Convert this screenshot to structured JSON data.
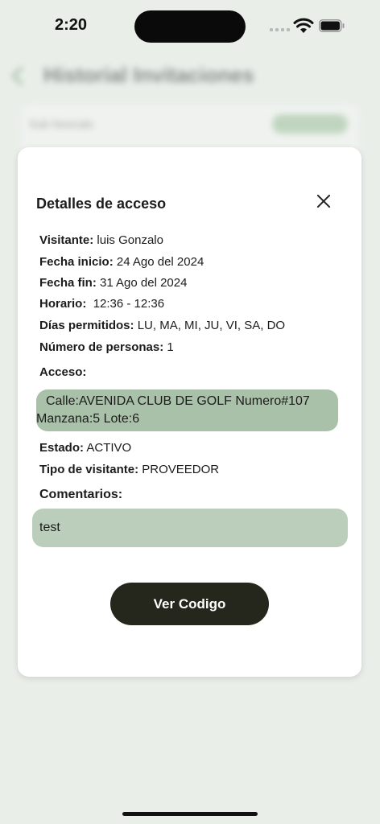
{
  "status_bar": {
    "time": "2:20",
    "icons": [
      "cellular-signal-icon",
      "wifi-icon",
      "battery-icon"
    ]
  },
  "background_page": {
    "title": "Historial Invitaciones",
    "card_label": "Sub Noncalo",
    "accent_color": "#5e8f5e"
  },
  "modal": {
    "title": "Detalles de acceso",
    "close_icon": "close-icon",
    "fields": {
      "visitante": {
        "label": "Visitante:",
        "value": "luis Gonzalo"
      },
      "fecha_inicio": {
        "label": "Fecha inicio:",
        "value": "24 Ago del 2024"
      },
      "fecha_fin": {
        "label": "Fecha fin:",
        "value": "31 Ago del 2024"
      },
      "horario": {
        "label": "Horario:",
        "value": "12:36 - 12:36"
      },
      "dias": {
        "label": "Días permitidos:",
        "value": "LU, MA, MI, JU, VI, SA, DO"
      },
      "personas": {
        "label": "Número de personas:",
        "value": "1"
      }
    },
    "acceso_label": "Acceso:",
    "acceso_line1": "Calle:AVENIDA CLUB DE GOLF Numero#107",
    "acceso_line2": "Manzana:5 Lote:6",
    "estado": {
      "label": "Estado:",
      "value": "ACTIVO"
    },
    "tipo_visitante": {
      "label": "Tipo de visitante:",
      "value": "PROVEEDOR"
    },
    "comentarios_label": "Comentarios:",
    "comentarios_value": "test",
    "button_label": "Ver Codigo",
    "colors": {
      "access_box": "#a9c1a9",
      "comments_box": "#bbcdbb",
      "button": "#25261c"
    }
  }
}
